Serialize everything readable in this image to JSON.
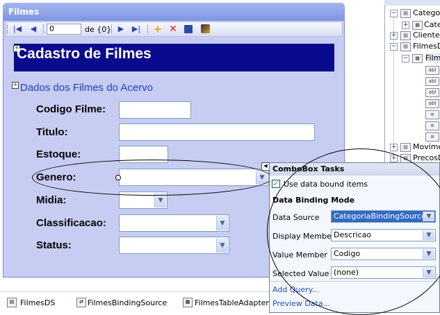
{
  "form": {
    "title": "Filmes",
    "navigator": {
      "position_value": "0",
      "count_label": "de {0}"
    },
    "header_title": "Cadastro de Filmes",
    "section_title": "Dados dos Filmes do Acervo",
    "fields": [
      {
        "label": "Codigo Filme:",
        "type": "textbox"
      },
      {
        "label": "Titulo:",
        "type": "textbox"
      },
      {
        "label": "Estoque:",
        "type": "textbox"
      },
      {
        "label": "Genero:",
        "type": "combobox"
      },
      {
        "label": "Midia:",
        "type": "combobox"
      },
      {
        "label": "Classificacao:",
        "type": "combobox"
      },
      {
        "label": "Status:",
        "type": "combobox"
      }
    ]
  },
  "combobox_tasks": {
    "title": "ComboBox Tasks",
    "use_data_bound_items": {
      "label": "Use data bound items",
      "checked": true
    },
    "binding_mode_title": "Data Binding Mode",
    "properties": [
      {
        "label": "Data Source",
        "value": "CategoriaBindingSource"
      },
      {
        "label": "Display Member",
        "value": "Descricao"
      },
      {
        "label": "Value Member",
        "value": "Codigo"
      },
      {
        "label": "Selected Value",
        "value": "(none)"
      }
    ],
    "links": [
      "Add Query...",
      "Preview Data..."
    ]
  },
  "data_sources_tree": {
    "items": [
      "Categor",
      "Cate",
      "ClienteD",
      "FilmesDS",
      "Filme",
      "abl",
      "abl",
      "abl",
      "abl",
      "",
      "",
      "",
      "",
      "Movimer",
      "PrecosD"
    ]
  },
  "component_tray": {
    "items": [
      "FilmesDS",
      "FilmesBindingSource",
      "FilmesTableAdapter"
    ]
  },
  "colors": {
    "header_bg": "#0a0a8c",
    "form_bg": "#c7cdf2",
    "section_title": "#1e3fc8",
    "selected_value_bg": "#316ac5",
    "link": "#1f4fc2"
  }
}
